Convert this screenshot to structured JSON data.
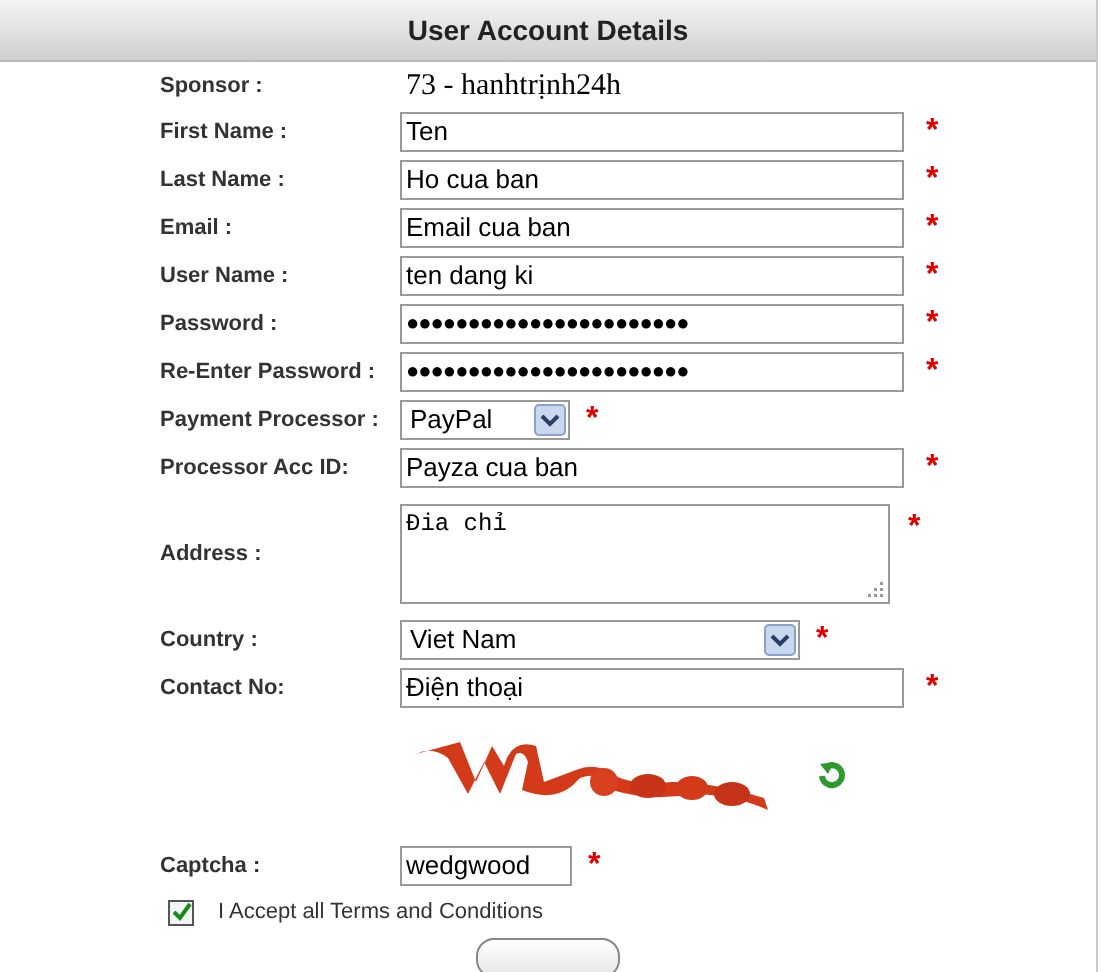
{
  "header": {
    "title": "User Account Details"
  },
  "sponsor": {
    "label": "Sponsor :",
    "value": "73 - hanhtrịnh24h"
  },
  "fields": [
    {
      "kind": "text",
      "label": "First Name :",
      "value": "Ten",
      "required": "*"
    },
    {
      "kind": "text",
      "label": "Last Name :",
      "value": "Ho cua ban",
      "required": "*"
    },
    {
      "kind": "text",
      "label": "Email :",
      "value": "Email cua ban",
      "required": "*"
    },
    {
      "kind": "text",
      "label": "User Name :",
      "value": "ten dang ki",
      "required": "*"
    },
    {
      "kind": "password",
      "label": "Password :",
      "value": "●●●●●●●●●●●●●●●●●●●●●●●",
      "required": "*"
    },
    {
      "kind": "password",
      "label": "Re-Enter Password :",
      "value": "●●●●●●●●●●●●●●●●●●●●●●●",
      "required": "*"
    },
    {
      "kind": "select-short",
      "label": "Payment Processor :",
      "value": "PayPal",
      "required": "*"
    },
    {
      "kind": "text",
      "label": "Processor Acc ID:",
      "value": "Payza cua ban",
      "required": "*"
    },
    {
      "kind": "textarea",
      "label": "Address :",
      "value": "Đia chỉ",
      "required": "*"
    },
    {
      "kind": "select",
      "label": "Country :",
      "value": "Viet Nam",
      "required": "*"
    },
    {
      "kind": "text",
      "label": "Contact No:",
      "value": "Điện thoại",
      "required": "*"
    }
  ],
  "captcha": {
    "label": "Captcha :",
    "value": "wedgwood",
    "required": "*"
  },
  "terms": {
    "label": "I Accept all Terms and Conditions",
    "checked": true
  }
}
